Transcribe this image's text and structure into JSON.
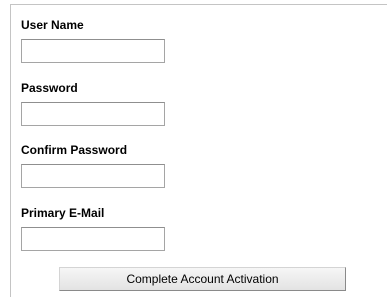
{
  "form": {
    "fields": [
      {
        "label": "User Name",
        "value": "",
        "placeholder": ""
      },
      {
        "label": "Password",
        "value": "",
        "placeholder": ""
      },
      {
        "label": "Confirm Password",
        "value": "",
        "placeholder": ""
      },
      {
        "label": "Primary E-Mail",
        "value": "",
        "placeholder": ""
      }
    ],
    "submit_label": "Complete Account Activation"
  }
}
